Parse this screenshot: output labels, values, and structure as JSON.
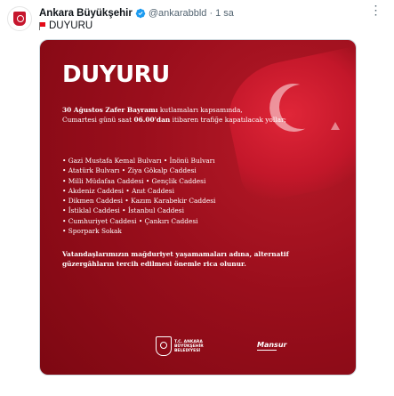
{
  "tweet": {
    "author_name": "Ankara Büyükşehir",
    "handle": "@ankarabbld",
    "separator": "·",
    "time": "1 sa",
    "text": "DUYURU",
    "more_icon": "more-icon",
    "verified_icon": "verified-icon",
    "flag_icon": "turkish-flag-icon"
  },
  "post": {
    "title": "DUYURU",
    "intro_bold_1": "30 Ağustos Zafer Bayramı",
    "intro_text_1": " kutlamaları kapsamında,",
    "intro_text_2": "Cumartesi günü saat ",
    "intro_bold_2": "06.00'dan",
    "intro_text_3": " itibaren trafiğe kapatılacak yollar;",
    "roads": [
      "• Gazi Mustafa Kemal Bulvarı • İnönü Bulvarı",
      "• Atatürk Bulvarı • Ziya Gökalp Caddesi",
      "• Milli Müdafaa Caddesi • Gençlik Caddesi",
      "• Akdeniz Caddesi • Anıt Caddesi",
      "• Dikmen Caddesi • Kazım Karabekir Caddesi",
      "• İstiklal Caddesi • İstanbul Caddesi",
      "• Cumhuriyet Caddesi • Çankırı Caddesi",
      "• Sporpark Sokak"
    ],
    "outro": "Vatandaşlarımızın mağduriyet yaşamamaları adına, alternatif güzergâhların tercih edilmesi önemle rica olunur.",
    "footer_org": "T.C. ANKARA BÜYÜKŞEHİR BELEDİYESİ",
    "footer_signature": "Mansur",
    "colors": {
      "background": "#9a0e1c",
      "accent": "#e30a17",
      "text": "#ffffff"
    }
  }
}
